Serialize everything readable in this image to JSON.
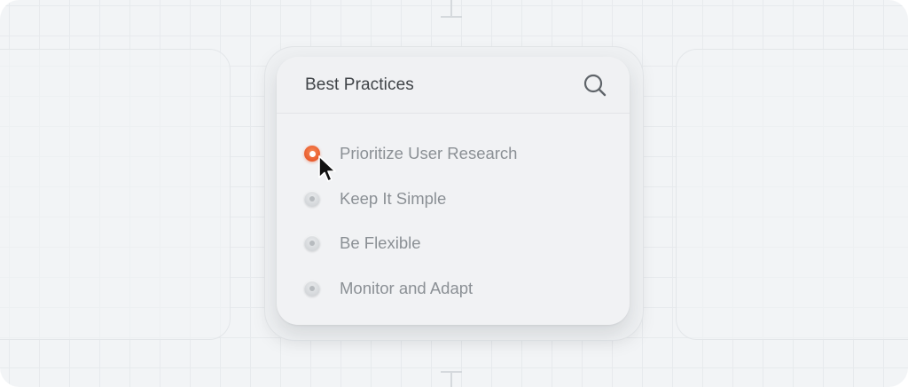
{
  "panel": {
    "title": "Best Practices",
    "search_icon": "search-icon",
    "options": [
      {
        "label": "Prioritize User Research",
        "selected": true
      },
      {
        "label": "Keep It Simple",
        "selected": false
      },
      {
        "label": "Be Flexible",
        "selected": false
      },
      {
        "label": "Monitor and Adapt",
        "selected": false
      }
    ]
  },
  "colors": {
    "accent": "#E8582A",
    "background": "#F2F4F6",
    "panel": "#F1F2F4",
    "title_text": "#3F4347",
    "option_text": "#8B9095"
  },
  "cursor_icon": "mouse-pointer-icon"
}
